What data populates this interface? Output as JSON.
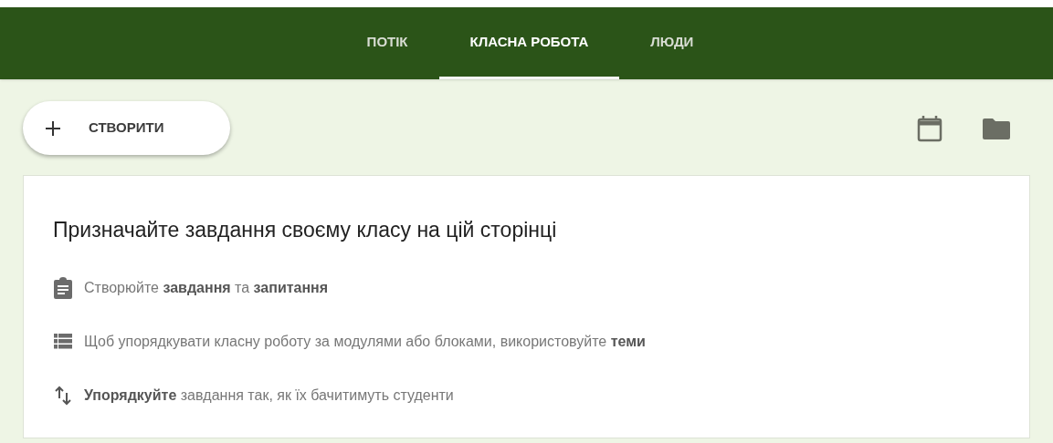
{
  "tabs": [
    {
      "label": "ПОТІК",
      "selected": false
    },
    {
      "label": "КЛАСНА РОБОТА",
      "selected": true
    },
    {
      "label": "ЛЮДИ",
      "selected": false
    }
  ],
  "create_button": {
    "label": "СТВОРИТИ"
  },
  "card": {
    "title": "Призначайте завдання своєму класу на цій сторінці",
    "items": [
      {
        "kind": "clipboard",
        "text": "Створюйте **завдання** та **запитання**"
      },
      {
        "kind": "list",
        "text": "Щоб упорядкувати класну роботу за модулями або блоками, використовуйте **теми**"
      },
      {
        "kind": "sort",
        "text": "**Упорядкуйте** завдання так, як їх бачитимуть студенти"
      }
    ]
  }
}
